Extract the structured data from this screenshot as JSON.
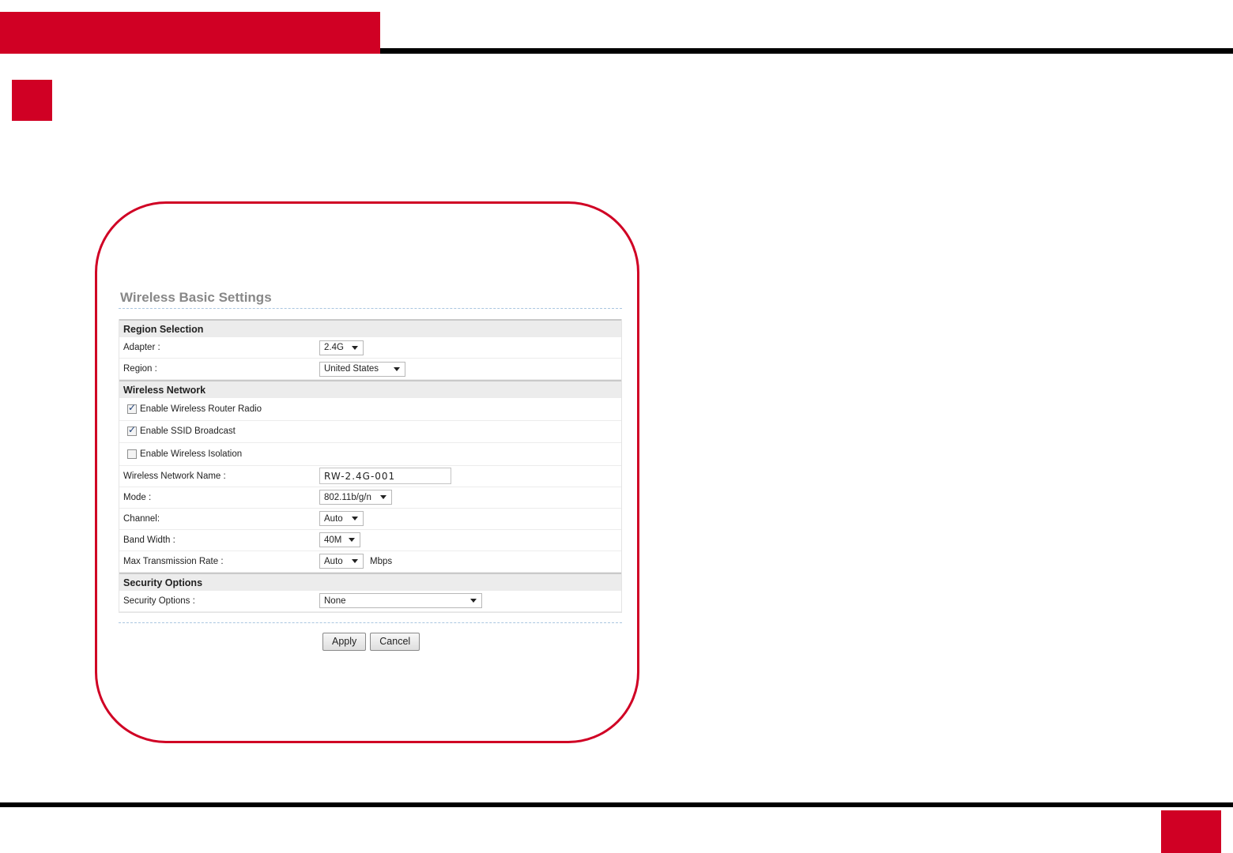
{
  "colors": {
    "brand_red": "#d00024",
    "rule_black": "#000000",
    "frame_border": "#d00024"
  },
  "panel": {
    "title": "Wireless Basic Settings",
    "sections": {
      "region": {
        "header": "Region Selection",
        "adapter": {
          "label": "Adapter :",
          "value": "2.4G"
        },
        "region": {
          "label": "Region :",
          "value": "United States"
        }
      },
      "wireless": {
        "header": "Wireless Network",
        "enable_radio": {
          "label": "Enable Wireless Router Radio",
          "checked": true
        },
        "enable_ssid": {
          "label": "Enable SSID Broadcast",
          "checked": true
        },
        "enable_isolation": {
          "label": "Enable Wireless Isolation",
          "checked": false
        },
        "network_name": {
          "label": "Wireless Network Name :",
          "value": "RW-2.4G-001"
        },
        "mode": {
          "label": "Mode :",
          "value": "802.11b/g/n"
        },
        "channel": {
          "label": "Channel:",
          "value": "Auto"
        },
        "band_width": {
          "label": "Band Width :",
          "value": "40M"
        },
        "max_rate": {
          "label": "Max Transmission Rate :",
          "value": "Auto",
          "unit": "Mbps"
        }
      },
      "security": {
        "header": "Security Options",
        "security_options": {
          "label": "Security Options :",
          "value": "None"
        }
      }
    },
    "buttons": {
      "apply": "Apply",
      "cancel": "Cancel"
    }
  }
}
